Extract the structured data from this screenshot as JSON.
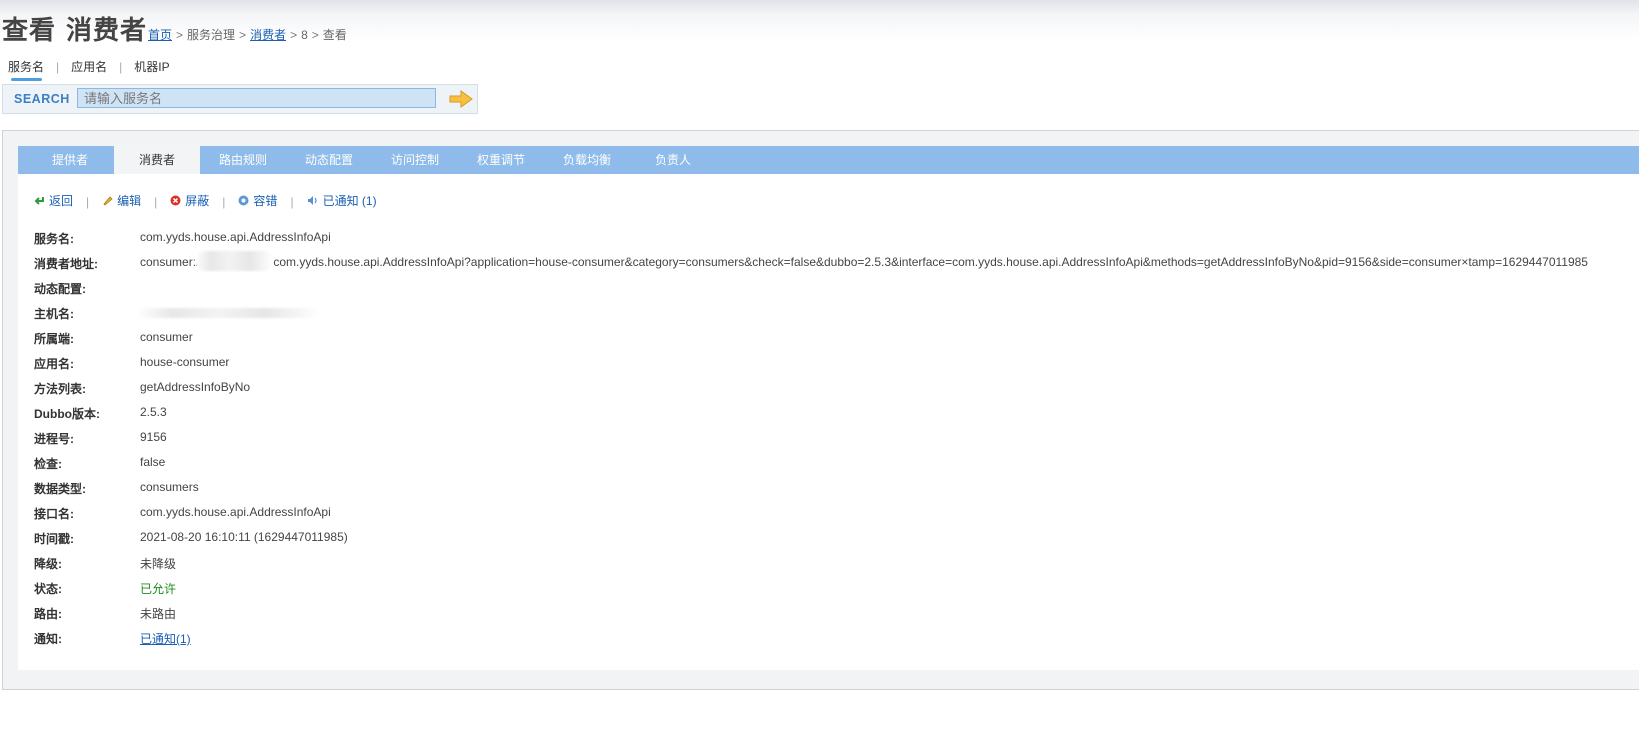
{
  "header": {
    "title": "查看 消费者",
    "breadcrumb": [
      "首页",
      "服务治理",
      "消费者",
      "8",
      "查看"
    ],
    "breadcrumb_sep": ">"
  },
  "search": {
    "tabs": [
      "服务名",
      "应用名",
      "机器IP"
    ],
    "tab_divider": "|",
    "label": "SEARCH",
    "placeholder": "请输入服务名",
    "go_icon": "arrow-right-icon"
  },
  "tabs": [
    "提供者",
    "消费者",
    "路由规则",
    "动态配置",
    "访问控制",
    "权重调节",
    "负载均衡",
    "负责人"
  ],
  "toolbar": {
    "back": "返回",
    "edit": "编辑",
    "block": "屏蔽",
    "tolerance": "容错",
    "notified": "已通知 (1)",
    "sep": "|"
  },
  "details": {
    "service_name": {
      "label": "服务名:",
      "value": "com.yyds.house.api.AddressInfoApi"
    },
    "address": {
      "label": "消费者地址:",
      "prefix": "consumer:/",
      "value": "com.yyds.house.api.AddressInfoApi?application=house-consumer&category=consumers&check=false&dubbo=2.5.3&interface=com.yyds.house.api.AddressInfoApi&methods=getAddressInfoByNo&pid=9156&side=consumer×tamp=1629447011985"
    },
    "dynamic_config": {
      "label": "动态配置:",
      "value": ""
    },
    "host": {
      "label": "主机名:",
      "value": ""
    },
    "side": {
      "label": "所属端:",
      "value": "consumer"
    },
    "application": {
      "label": "应用名:",
      "value": "house-consumer"
    },
    "methods": {
      "label": "方法列表:",
      "value": "getAddressInfoByNo"
    },
    "dubbo_version": {
      "label": "Dubbo版本:",
      "value": "2.5.3"
    },
    "pid": {
      "label": "进程号:",
      "value": "9156"
    },
    "check": {
      "label": "检查:",
      "value": "false"
    },
    "category": {
      "label": "数据类型:",
      "value": "consumers"
    },
    "interface": {
      "label": "接口名:",
      "value": "com.yyds.house.api.AddressInfoApi"
    },
    "timestamp": {
      "label": "时间戳:",
      "value": "2021-08-20 16:10:11 (1629447011985)"
    },
    "degrade": {
      "label": "降级:",
      "value": "未降级"
    },
    "status": {
      "label": "状态:",
      "value": "已允许"
    },
    "route": {
      "label": "路由:",
      "value": "未路由"
    },
    "notify": {
      "label": "通知:",
      "value": "已通知(1)"
    }
  },
  "colors": {
    "tab_bar": "#8fbbea",
    "link": "#1a5fb4",
    "status_ok": "#1c8c1c"
  }
}
